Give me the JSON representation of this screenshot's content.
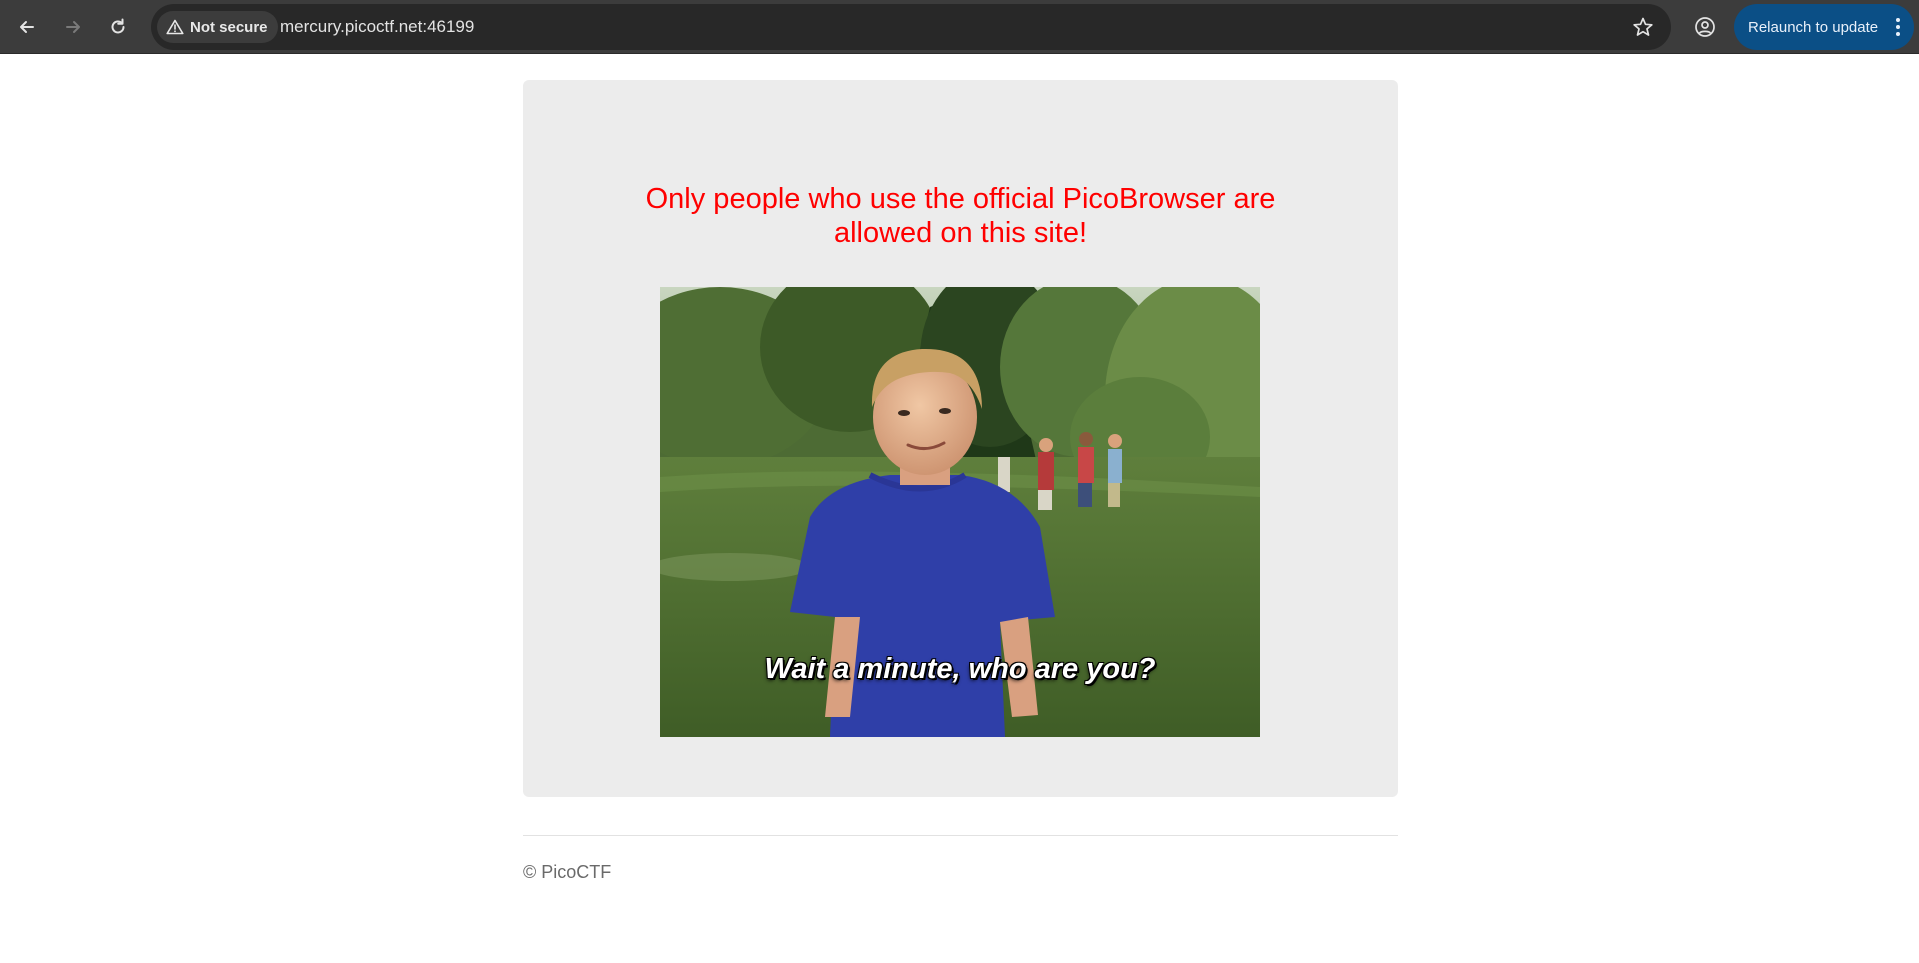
{
  "browser": {
    "security_label": "Not secure",
    "url": "mercury.picoctf.net:46199",
    "relaunch_label": "Relaunch to update",
    "icons": {
      "back": "arrow-left-icon",
      "forward": "arrow-right-icon",
      "reload": "reload-icon",
      "security": "warning-triangle-icon",
      "bookmark": "star-icon",
      "profile": "profile-icon",
      "menu": "kebab-menu-icon"
    }
  },
  "page": {
    "headline_line1": "Only people who use the official PicoBrowser are",
    "headline_line2": "allowed on this site!",
    "meme_caption": "Wait a minute, who are you?",
    "footer": "© PicoCTF"
  },
  "colors": {
    "headline": "#ff0000",
    "card_background": "#ececec",
    "relaunch_button": "#0b4f86",
    "chrome_background": "#3c3c3c"
  }
}
